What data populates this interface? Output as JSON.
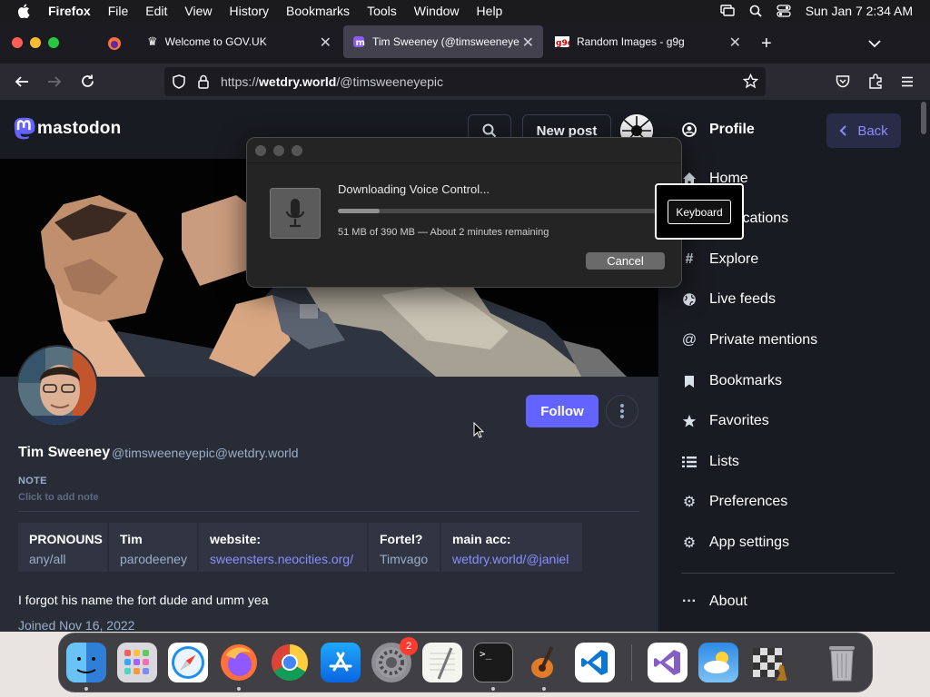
{
  "menubar": {
    "items": [
      "Firefox",
      "File",
      "Edit",
      "View",
      "History",
      "Bookmarks",
      "Tools",
      "Window",
      "Help"
    ],
    "clock": "Sun Jan 7  2:34 AM"
  },
  "tabs": [
    {
      "label": "Welcome to GOV.UK",
      "icon": "crown-icon"
    },
    {
      "label": "Tim Sweeney (@timsweeneyepic",
      "icon": "mastodon-icon"
    },
    {
      "label": "Random Images - g9g",
      "icon": "g9g-icon"
    }
  ],
  "url": {
    "prefix": "https://",
    "domain": "wetdry.world",
    "path": "/@timsweeneyepic"
  },
  "mastodon": {
    "logo_text": "mastodon",
    "new_post": "New post",
    "follow": "Follow",
    "display_name": "Tim Sweeney",
    "handle": "@timsweeneyepic@wetdry.world",
    "note_label": "NOTE",
    "note_placeholder": "Click to add note",
    "fields": [
      {
        "key": "PRONOUNS",
        "value": "any/all",
        "link": false
      },
      {
        "key": "Tim",
        "value": "parodeeney",
        "link": false
      },
      {
        "key": "website:",
        "value": "sweensters.neocities.org/",
        "link": true
      },
      {
        "key": "Fortel?",
        "value": "Timvago",
        "link": false
      },
      {
        "key": "main acc:",
        "value": "wetdry.world/@janiel",
        "link": true
      }
    ],
    "bio": "I forgot his name the fort dude and umm yea",
    "joined": "Joined Nov 16, 2022"
  },
  "sidebar": {
    "profile_title": "Profile",
    "back": "Back",
    "items": [
      {
        "label": "Home",
        "icon": "home-icon"
      },
      {
        "label": "Notifications",
        "icon": "bell-icon"
      },
      {
        "label": "Explore",
        "icon": "hashtag-icon"
      },
      {
        "label": "Live feeds",
        "icon": "globe-icon"
      },
      {
        "label": "Private mentions",
        "icon": "at-icon"
      },
      {
        "label": "Bookmarks",
        "icon": "bookmark-icon"
      },
      {
        "label": "Favorites",
        "icon": "star-icon"
      },
      {
        "label": "Lists",
        "icon": "list-icon"
      },
      {
        "label": "Preferences",
        "icon": "gear-icon"
      },
      {
        "label": "App settings",
        "icon": "gears-icon"
      },
      {
        "label": "About",
        "icon": "ellipsis-icon"
      }
    ]
  },
  "dialog": {
    "title": "Downloading Voice Control...",
    "status": "51 MB of 390 MB — About 2 minutes remaining",
    "progress": 0.13,
    "cancel": "Cancel"
  },
  "keyboard_tooltip": "Keyboard",
  "dock": {
    "items": [
      "finder-icon",
      "launchpad-icon",
      "safari-icon",
      "firefox-icon",
      "chrome-icon",
      "app-store-icon",
      "system-settings-icon",
      "textedit-icon",
      "terminal-icon",
      "garageband-icon",
      "vscode-icon",
      "visual-studio-icon",
      "weather-icon",
      "chess-icon",
      "trash-icon"
    ],
    "settings_badge": "2"
  }
}
